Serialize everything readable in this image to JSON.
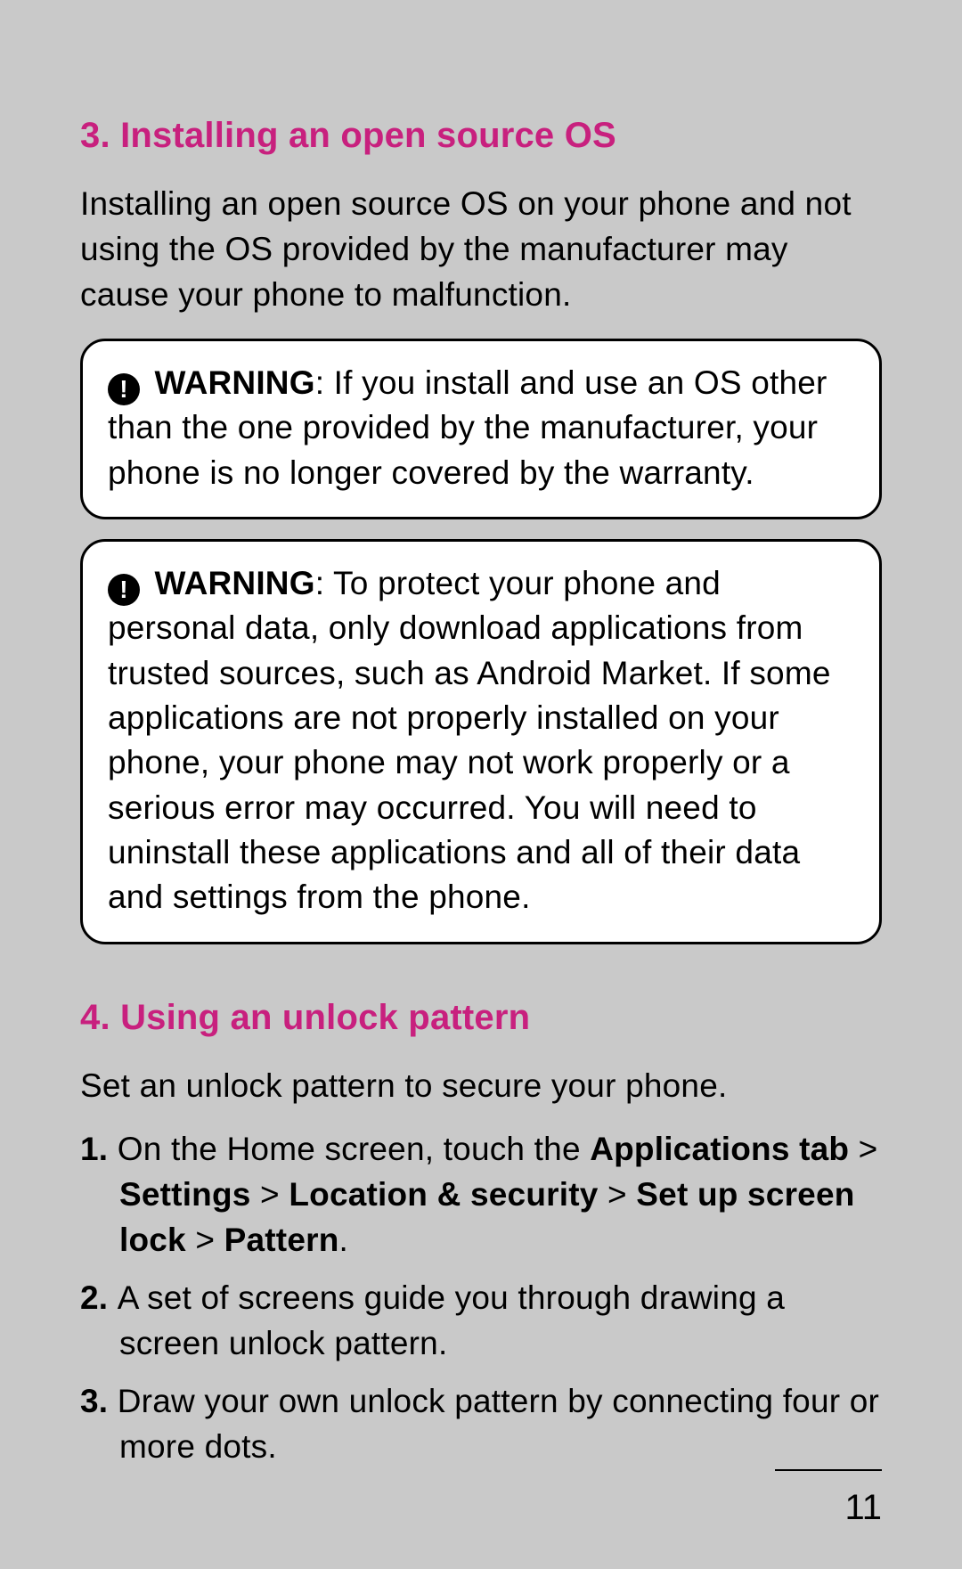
{
  "section3": {
    "heading": "3. Installing an open source OS",
    "intro": "Installing an open source OS on your phone and not using the OS provided by the manufacturer may cause your phone to malfunction.",
    "warning1": {
      "label": "WARNING",
      "text": ": If you install and use an OS other than the one provided by the manufacturer, your phone is no longer covered by the warranty."
    },
    "warning2": {
      "label": "WARNING",
      "text": ": To protect your phone and personal data, only download applications from trusted sources, such as Android Market.  If some applications are not properly installed on your phone, your phone may not work properly or a serious error may occurred. You will need to uninstall these applications and all of their data and settings from the phone."
    }
  },
  "section4": {
    "heading": "4. Using an unlock pattern",
    "intro": "Set an unlock pattern to secure your phone.",
    "steps": {
      "s1_num": "1. ",
      "s1_a": "On the Home screen, touch the ",
      "s1_b1": "Applications tab",
      "s1_c1": " > ",
      "s1_b2": "Settings",
      "s1_c2": " > ",
      "s1_b3": "Location & security",
      "s1_c3": " > ",
      "s1_b4": "Set up screen lock",
      "s1_c4": " > ",
      "s1_b5": "Pattern",
      "s1_c5": ".",
      "s2_num": "2. ",
      "s2_text": "A set of screens guide you through drawing a screen unlock pattern.",
      "s3_num": "3. ",
      "s3_text": "Draw your own unlock pattern by connecting four or more dots."
    }
  },
  "page_number": "11",
  "icons": {
    "warning_glyph": "!"
  }
}
